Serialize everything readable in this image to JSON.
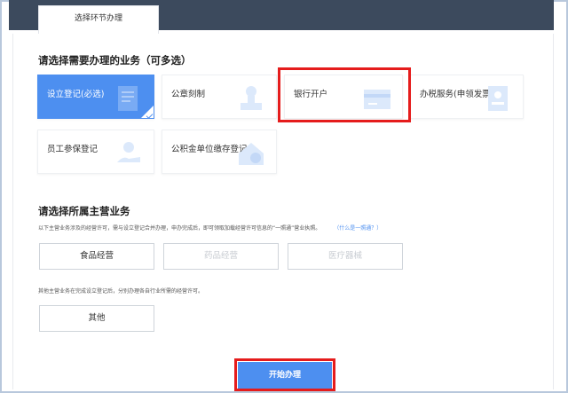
{
  "tab": {
    "label": "选择环节办理"
  },
  "section1": {
    "title": "请选择需要办理的业务（可多选）",
    "cards": [
      {
        "label": "设立登记(必选)",
        "selected": true,
        "icon": "document-icon"
      },
      {
        "label": "公章刻制",
        "selected": false,
        "icon": "stamp-icon"
      },
      {
        "label": "银行开户",
        "selected": false,
        "icon": "bank-card-icon"
      },
      {
        "label": "办税服务(申领发票)",
        "selected": false,
        "icon": "tax-invoice-icon"
      },
      {
        "label": "员工参保登记",
        "selected": false,
        "icon": "user-hand-icon"
      },
      {
        "label": "公积金单位缴存登记",
        "selected": false,
        "icon": "house-fund-icon"
      }
    ]
  },
  "section2": {
    "title": "请选择所属主营业务",
    "note": "以下主营业务涉及的经营许可，需与设立登记合并办理，申办完成后，即可领取加载经营许可信息的“一照通”营业执照。",
    "note_link": "（什么是一照通？）",
    "options": [
      {
        "label": "食品经营",
        "disabled": false
      },
      {
        "label": "药品经营",
        "disabled": true
      },
      {
        "label": "医疗器械",
        "disabled": true
      }
    ],
    "other_note": "其他主营业务在完成设立登记后，分别办理各自行业所需的经营许可。",
    "other_label": "其他"
  },
  "start_button": {
    "label": "开始办理"
  },
  "colors": {
    "accent": "#4d8ff0",
    "highlight": "#e51c1c",
    "header": "#3c4a5d"
  }
}
